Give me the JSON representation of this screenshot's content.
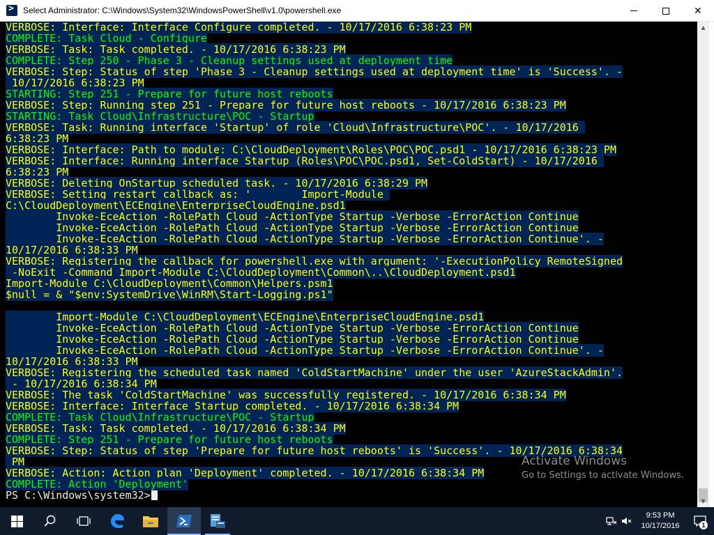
{
  "window": {
    "title": "Select Administrator: C:\\Windows\\System32\\WindowsPowerShell\\v1.0\\powershell.exe",
    "minimize_icon": "minimize-icon",
    "maximize_icon": "maximize-icon",
    "close_label": "✕"
  },
  "colors": {
    "console_background": "#012456",
    "verbose_text": "#ffff00",
    "status_text": "#00ff00",
    "prompt_text": "#eeedf0"
  },
  "console": {
    "lines": [
      {
        "style": "y",
        "text": "VERBOSE: Interface: Interface Configure completed. - 10/17/2016 6:38:23 PM"
      },
      {
        "style": "g",
        "text": "COMPLETE: Task Cloud - Configure"
      },
      {
        "style": "y",
        "text": "VERBOSE: Task: Task completed. - 10/17/2016 6:38:23 PM"
      },
      {
        "style": "g",
        "text": "COMPLETE: Step 250 - Phase 3 - Cleanup settings used at deployment time"
      },
      {
        "style": "y",
        "text": "VERBOSE: Step: Status of step 'Phase 3 - Cleanup settings used at deployment time' is 'Success'. -"
      },
      {
        "style": "y",
        "text": " 10/17/2016 6:38:23 PM"
      },
      {
        "style": "g",
        "text": "STARTING: Step 251 - Prepare for future host reboots"
      },
      {
        "style": "y",
        "text": "VERBOSE: Step: Running step 251 - Prepare for future host reboots - 10/17/2016 6:38:23 PM"
      },
      {
        "style": "g",
        "text": "STARTING: Task Cloud\\Infrastructure\\POC - Startup"
      },
      {
        "style": "y",
        "text": "VERBOSE: Task: Running interface 'Startup' of role 'Cloud\\Infrastructure\\POC'. - 10/17/2016 "
      },
      {
        "style": "y",
        "text": "6:38:23 PM"
      },
      {
        "style": "y",
        "text": "VERBOSE: Interface: Path to module: C:\\CloudDeployment\\Roles\\POC\\POC.psd1 - 10/17/2016 6:38:23 PM"
      },
      {
        "style": "y",
        "text": "VERBOSE: Interface: Running interface Startup (Roles\\POC\\POC.psd1, Set-ColdStart) - 10/17/2016 "
      },
      {
        "style": "y",
        "text": "6:38:23 PM"
      },
      {
        "style": "y",
        "text": "VERBOSE: Deleting OnStartup scheduled task. - 10/17/2016 6:38:29 PM"
      },
      {
        "style": "y",
        "text": "VERBOSE: Setting restart callback as: '        Import-Module "
      },
      {
        "style": "y",
        "text": "C:\\CloudDeployment\\ECEngine\\EnterpriseCloudEngine.psd1"
      },
      {
        "style": "y",
        "text": "        Invoke-EceAction -RolePath Cloud -ActionType Startup -Verbose -ErrorAction Continue"
      },
      {
        "style": "y",
        "text": "        Invoke-EceAction -RolePath Cloud -ActionType Startup -Verbose -ErrorAction Continue"
      },
      {
        "style": "y",
        "text": "        Invoke-EceAction -RolePath Cloud -ActionType Startup -Verbose -ErrorAction Continue'. -"
      },
      {
        "style": "y",
        "text": "10/17/2016 6:38:33 PM"
      },
      {
        "style": "y",
        "text": "VERBOSE: Registering the callback for powershell.exe with argument: '-ExecutionPolicy RemoteSigned"
      },
      {
        "style": "y",
        "text": " -NoExit -Command Import-Module C:\\CloudDeployment\\Common\\..\\CloudDeployment.psd1"
      },
      {
        "style": "y",
        "text": "Import-Module C:\\CloudDeployment\\Common\\Helpers.psm1"
      },
      {
        "style": "y",
        "text": "$null = & \"$env:SystemDrive\\WinRM\\Start-Logging.ps1\""
      },
      {
        "style": "y",
        "text": ""
      },
      {
        "style": "y",
        "text": "        Import-Module C:\\CloudDeployment\\ECEngine\\EnterpriseCloudEngine.psd1"
      },
      {
        "style": "y",
        "text": "        Invoke-EceAction -RolePath Cloud -ActionType Startup -Verbose -ErrorAction Continue"
      },
      {
        "style": "y",
        "text": "        Invoke-EceAction -RolePath Cloud -ActionType Startup -Verbose -ErrorAction Continue"
      },
      {
        "style": "y",
        "text": "        Invoke-EceAction -RolePath Cloud -ActionType Startup -Verbose -ErrorAction Continue'. -"
      },
      {
        "style": "y",
        "text": "10/17/2016 6:38:33 PM"
      },
      {
        "style": "y",
        "text": "VERBOSE: Registering the scheduled task named 'ColdStartMachine' under the user 'AzureStackAdmin'."
      },
      {
        "style": "y",
        "text": " - 10/17/2016 6:38:34 PM"
      },
      {
        "style": "y",
        "text": "VERBOSE: The task 'ColdStartMachine' was successfully registered. - 10/17/2016 6:38:34 PM"
      },
      {
        "style": "y",
        "text": "VERBOSE: Interface: Interface Startup completed. - 10/17/2016 6:38:34 PM"
      },
      {
        "style": "g",
        "text": "COMPLETE: Task Cloud\\Infrastructure\\POC - Startup"
      },
      {
        "style": "y",
        "text": "VERBOSE: Task: Task completed. - 10/17/2016 6:38:34 PM"
      },
      {
        "style": "g",
        "text": "COMPLETE: Step 251 - Prepare for future host reboots"
      },
      {
        "style": "y",
        "text": "VERBOSE: Step: Status of step 'Prepare for future host reboots' is 'Success'. - 10/17/2016 6:38:34"
      },
      {
        "style": "y",
        "text": " PM"
      },
      {
        "style": "y",
        "text": "VERBOSE: Action: Action plan 'Deployment' completed. - 10/17/2016 6:38:34 PM"
      },
      {
        "style": "g",
        "text": "COMPLETE: Action 'Deployment'"
      }
    ],
    "prompt": "PS C:\\Windows\\system32>"
  },
  "watermark": {
    "line1": "Activate Windows",
    "line2": "Go to Settings to activate Windows."
  },
  "taskbar": {
    "items": [
      {
        "name": "start-button",
        "icon": "windows-logo-icon"
      },
      {
        "name": "search-button",
        "icon": "search-icon"
      },
      {
        "name": "task-view-button",
        "icon": "task-view-icon"
      },
      {
        "name": "edge-button",
        "icon": "edge-browser-icon"
      },
      {
        "name": "file-explorer-button",
        "icon": "folder-icon"
      },
      {
        "name": "powershell-button",
        "icon": "powershell-icon"
      },
      {
        "name": "server-manager-button",
        "icon": "server-manager-icon"
      }
    ],
    "clock_time": "9:53 PM",
    "clock_date": "10/17/2016",
    "notification_count": "1"
  }
}
